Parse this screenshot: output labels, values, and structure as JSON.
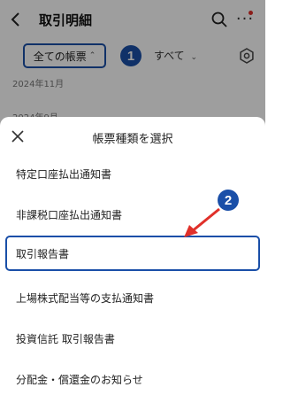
{
  "header": {
    "title": "取引明細",
    "back_icon": "chevron-left-icon",
    "search_icon": "search-icon",
    "more_icon": "more-dots-icon",
    "more_dots": "···"
  },
  "filters": {
    "document_type": "全ての帳票",
    "period": "すべて",
    "caret": "⌃"
  },
  "badges": {
    "one": "1",
    "two": "2"
  },
  "months": [
    "2024年11月",
    "2024年9月"
  ],
  "sheet": {
    "title": "帳票種類を選択",
    "options": [
      "特定口座払出通知書",
      "非課税口座払出通知書",
      "取引報告書",
      "上場株式配当等の支払通知書",
      "投資信託 取引報告書",
      "分配金・償還金のお知らせ"
    ],
    "highlighted_index": 2
  },
  "colors": {
    "highlight": "#1a4fa8",
    "annotation_arrow": "#e0302a",
    "notification_dot": "#e0302a"
  }
}
